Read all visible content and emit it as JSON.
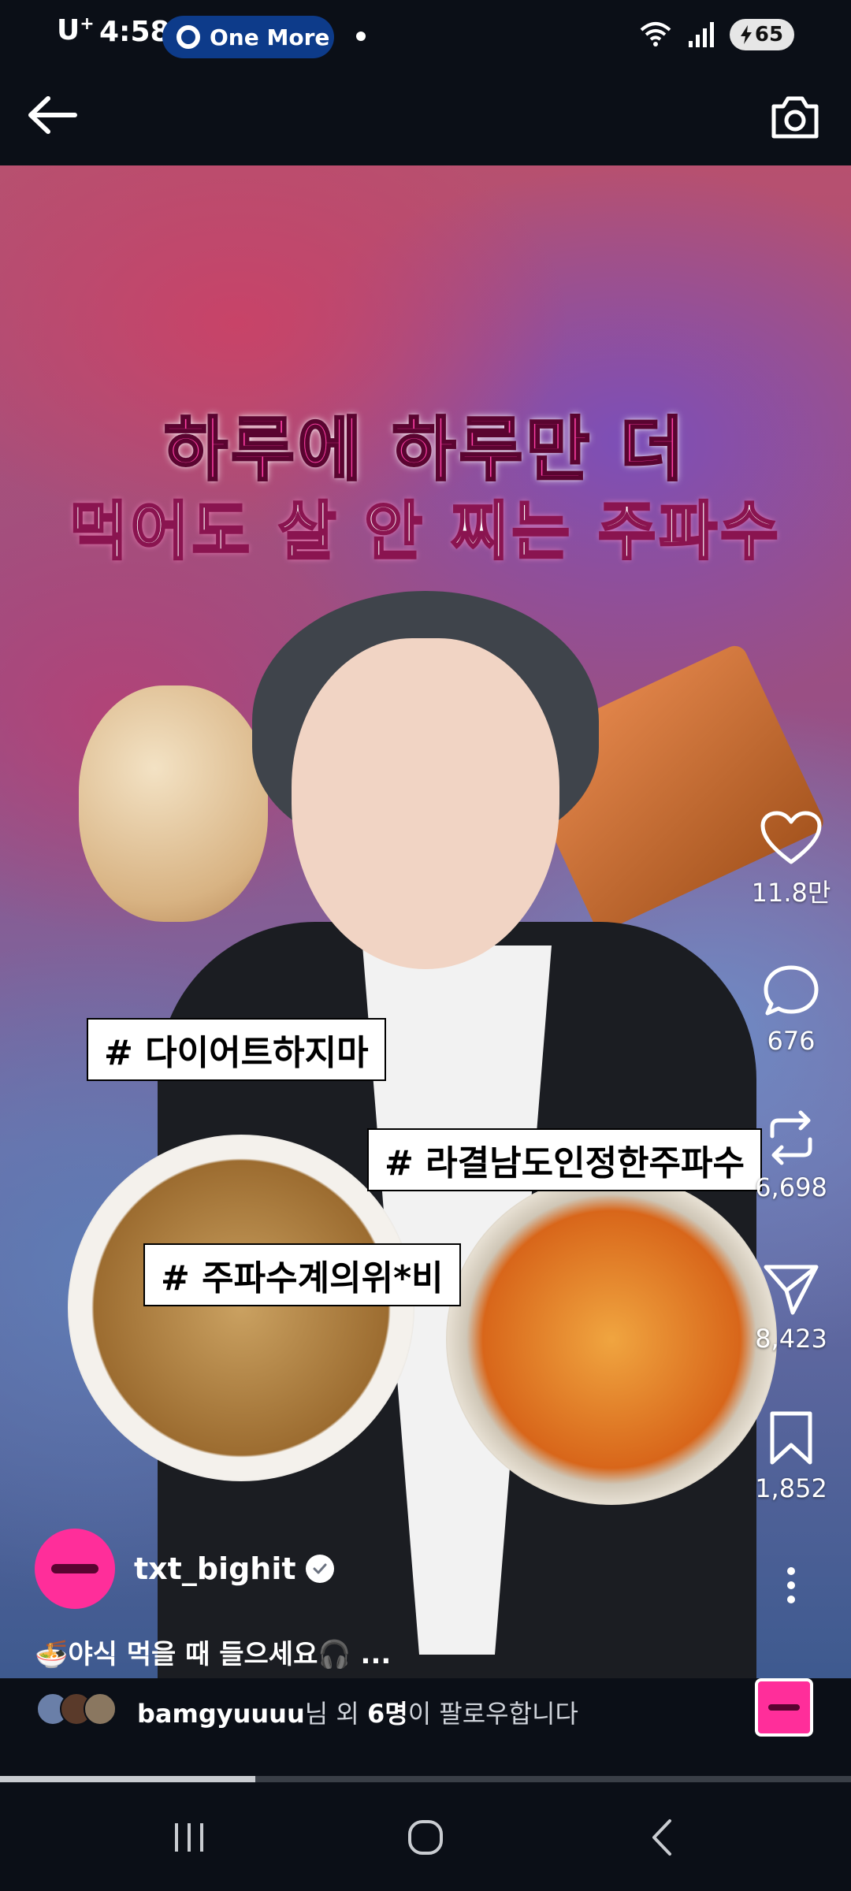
{
  "status_bar": {
    "carrier": "U",
    "carrier_sup": "+",
    "time": "4:58",
    "music_chip": "One More",
    "battery": "65"
  },
  "media": {
    "headline_1": "하루에 하루만 더",
    "headline_2": "먹어도 살 안 찌는 주파수",
    "tags": [
      "# 다이어트하지마",
      "# 라결남도인정한주파수",
      "# 주파수계의위*비"
    ]
  },
  "actions": {
    "likes": "11.8만",
    "comments": "676",
    "reposts": "6,698",
    "shares": "8,423",
    "saves": "1,852"
  },
  "post": {
    "username": "txt_bighit",
    "caption": "🍜야식 먹을 때 들으세요🎧 ..."
  },
  "followers": {
    "name": "bamgyuuuu",
    "suffix_1": "님 외 ",
    "count": "6명",
    "suffix_2": "이 팔로우합니다"
  },
  "video_progress": 0.3,
  "colors": {
    "accent_pink": "#ff2e9a",
    "background": "#0b0f17",
    "status_chip": "#0d3b8a"
  },
  "icons": [
    "back-arrow-icon",
    "camera-icon",
    "heart-icon",
    "comment-icon",
    "repost-icon",
    "send-icon",
    "bookmark-icon",
    "more-vertical-icon",
    "verified-icon",
    "recent-apps-icon",
    "home-icon",
    "nav-back-icon"
  ]
}
